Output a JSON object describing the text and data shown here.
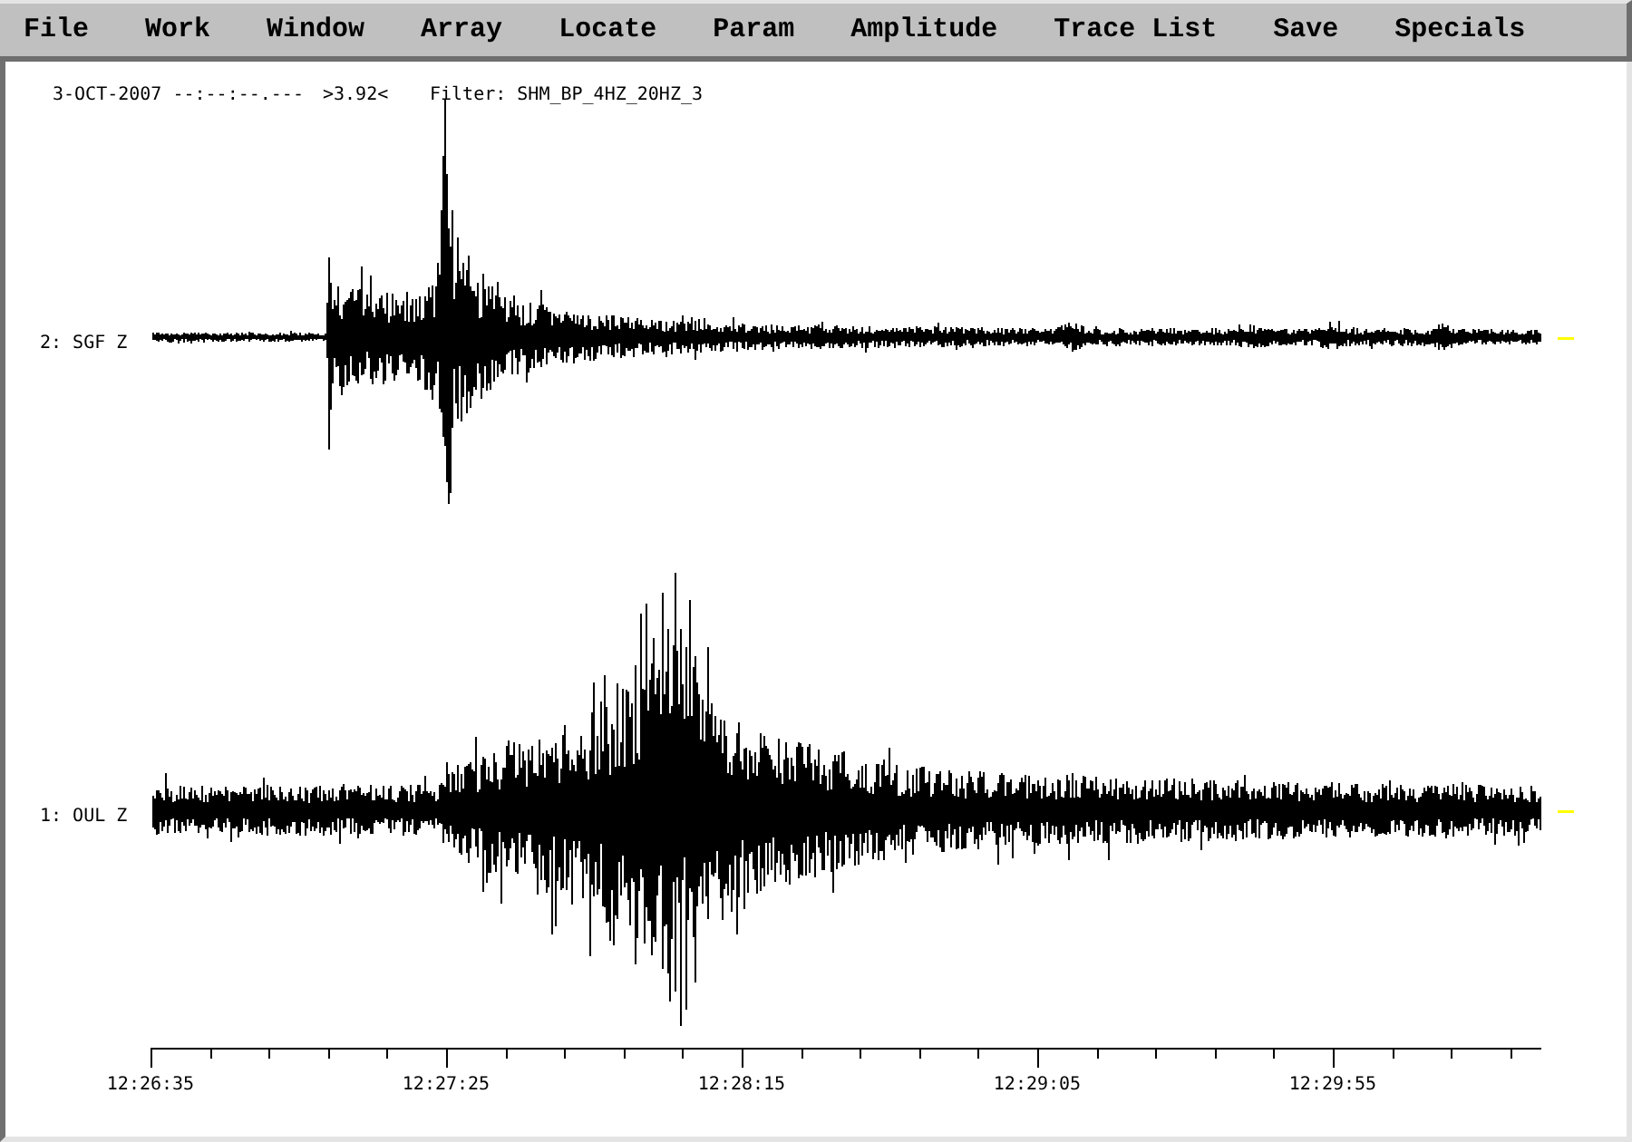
{
  "menu": [
    "File",
    "Work",
    "Window",
    "Array",
    "Locate",
    "Param",
    "Amplitude",
    "Trace List",
    "Save",
    "Specials"
  ],
  "header": {
    "date_time": "3-OCT-2007 --:--:--.---",
    "value": ">3.92<",
    "filter": "Filter: SHM_BP_4HZ_20HZ_3"
  },
  "traces": [
    {
      "label": "2: SGF Z"
    },
    {
      "label": "1: OUL Z"
    }
  ],
  "time_axis": {
    "labels": [
      "12:26:35",
      "12:27:25",
      "12:28:15",
      "12:29:05",
      "12:29:55"
    ]
  }
}
